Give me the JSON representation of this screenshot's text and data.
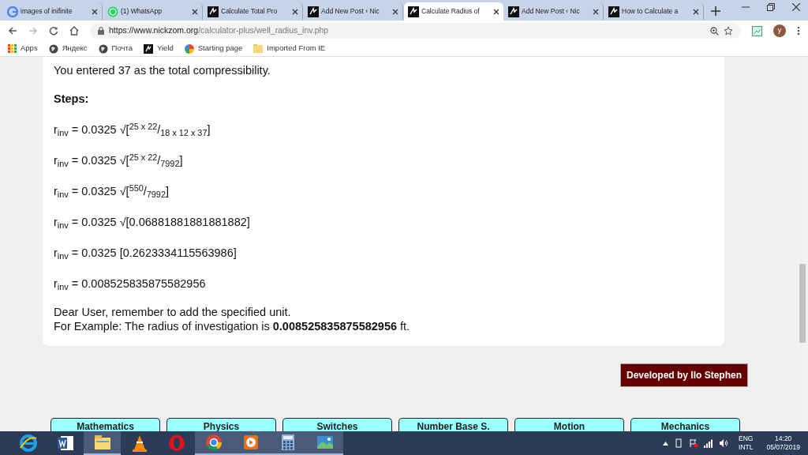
{
  "browser": {
    "tabs": [
      {
        "title": "images of inifinite",
        "selected": false,
        "kind": "google"
      },
      {
        "title": "(1) WhatsApp",
        "selected": false,
        "kind": "whatsapp"
      },
      {
        "title": "Calculate Total Pro",
        "selected": false,
        "kind": "site"
      },
      {
        "title": "Add New Post ‹ Nic",
        "selected": false,
        "kind": "site"
      },
      {
        "title": "Calculate Radius of",
        "selected": true,
        "kind": "site"
      },
      {
        "title": "Add New Post ‹ Nic",
        "selected": false,
        "kind": "site"
      },
      {
        "title": "How to Calculate a",
        "selected": false,
        "kind": "site"
      }
    ],
    "url_host": "https://www.nickzom.org",
    "url_path": "/calculator-plus/well_radius_inv.php",
    "profile_initial": "y",
    "bookmarks": [
      {
        "label": "Apps",
        "kind": "grid"
      },
      {
        "label": "Яндекс",
        "kind": "globe"
      },
      {
        "label": "Почта",
        "kind": "globe"
      },
      {
        "label": "Yield",
        "kind": "site"
      },
      {
        "label": "Starting page",
        "kind": "pinwheel"
      },
      {
        "label": "Imported From IE",
        "kind": "folder"
      }
    ]
  },
  "result": {
    "intro": "You entered 37 as the total compressibility.",
    "steps_heading": "Steps:",
    "steps": [
      "r$_{inv}$ = 0.0325 √[$^{25 x 22}$/$_{18 x 12 x 37}$]",
      "r$_{inv}$ = 0.0325 √[$^{25 x 22}$/$_{7992}$]",
      "r$_{inv}$ = 0.0325 √[$^{550}$/$_{7992}$]",
      "r$_{inv}$ = 0.0325 √[0.06881881881881882]",
      "r$_{inv}$ = 0.0325 [0.2623334115563986]",
      "r$_{inv}$ = 0.008525835875582956"
    ],
    "note": "Dear User, remember to add the specified unit.",
    "example": "For Example: The radius of investigation is **0.008525835875582956** ft."
  },
  "credit": "Developed by Ilo Stephen",
  "nav_buttons": [
    "Mathematics",
    "Physics",
    "Switches",
    "Number Base S.",
    "Motion",
    "Mechanics"
  ],
  "taskbar": {
    "apps": [
      {
        "kind": "ie",
        "selected": false
      },
      {
        "kind": "word",
        "selected": false
      },
      {
        "kind": "explorer",
        "selected": true
      },
      {
        "kind": "vlc",
        "selected": false
      },
      {
        "kind": "opera",
        "selected": false
      },
      {
        "kind": "chrome",
        "selected": true
      },
      {
        "kind": "media",
        "selected": true
      },
      {
        "kind": "calculator",
        "selected": true
      },
      {
        "kind": "photos",
        "selected": true
      }
    ],
    "lang": "ENG",
    "layout": "INTL",
    "time": "14:20",
    "date": "05/07/2019"
  }
}
